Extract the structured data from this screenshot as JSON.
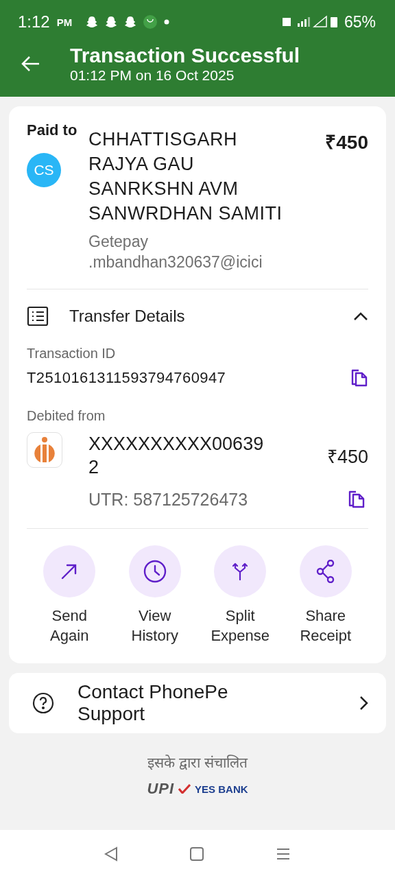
{
  "status_bar": {
    "time": "1:12",
    "period": "PM",
    "battery": "65%"
  },
  "header": {
    "title": "Transaction Successful",
    "subtitle": "01:12 PM on 16 Oct 2025"
  },
  "payment": {
    "label": "Paid to",
    "avatar": "CS",
    "name": "CHHATTISGARH RAJYA GAU SANRKSHN AVM SANWRDHAN SAMITI",
    "amount": "₹450",
    "upi_id": "Getepay .mbandhan320637@icici"
  },
  "transfer_details": {
    "title": "Transfer Details",
    "expanded": true,
    "transaction_id_label": "Transaction ID",
    "transaction_id": "T2510161311593794760947",
    "debited_label": "Debited from",
    "account": "XXXXXXXXXX006392",
    "amount": "₹450",
    "utr": "UTR: 587125726473"
  },
  "actions": [
    {
      "kind": "send",
      "label": "Send Again"
    },
    {
      "kind": "history",
      "label": "View History"
    },
    {
      "kind": "split",
      "label": "Split Expense"
    },
    {
      "kind": "share",
      "label": "Share Receipt"
    }
  ],
  "support": {
    "label": "Contact PhonePe Support"
  },
  "footer": {
    "powered_by": "इसके द्वारा संचालित",
    "upi": "UPI",
    "bank": "YES BANK"
  }
}
